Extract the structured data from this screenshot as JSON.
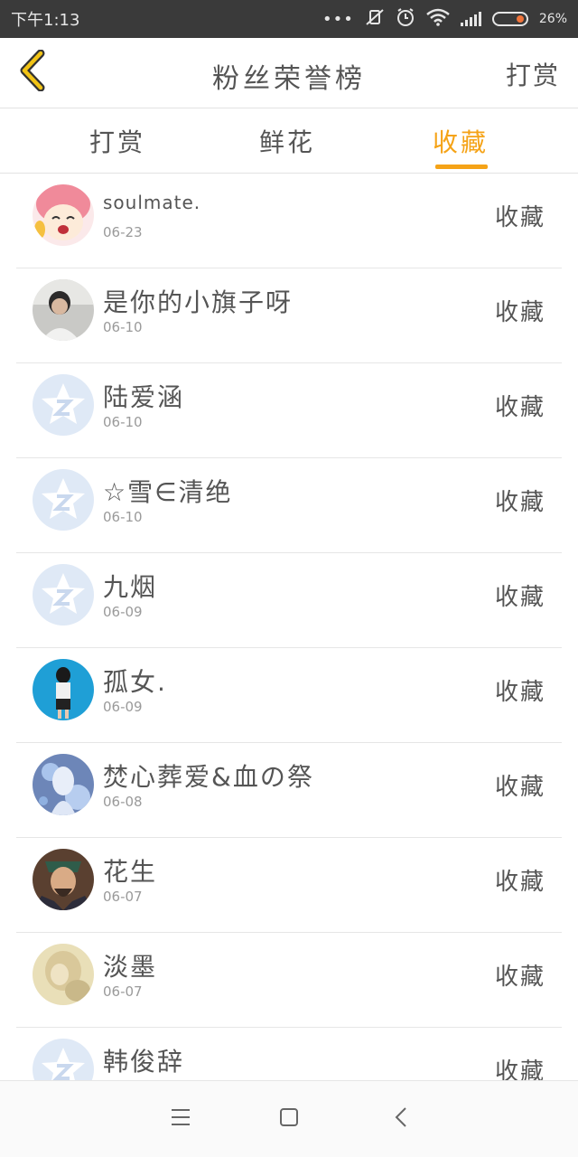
{
  "status_bar": {
    "time": "下午1:13",
    "battery": "26%",
    "accent": "#f0743a"
  },
  "header": {
    "title": "粉丝荣誉榜",
    "action": "打赏"
  },
  "tabs": [
    {
      "label": "打赏",
      "active": false
    },
    {
      "label": "鲜花",
      "active": false
    },
    {
      "label": "收藏",
      "active": true
    }
  ],
  "accent_color": "#f5a317",
  "fans": [
    {
      "name": "soulmate.",
      "date": "06-23",
      "action": "收藏",
      "avatar": "anime-pink-hair"
    },
    {
      "name": "是你的小旗子呀",
      "date": "06-10",
      "action": "收藏",
      "avatar": "photo-person"
    },
    {
      "name": "陆爱涵",
      "date": "06-10",
      "action": "收藏",
      "avatar": "default-qq"
    },
    {
      "name": "☆雪∈清绝",
      "date": "06-10",
      "action": "收藏",
      "avatar": "default-qq"
    },
    {
      "name": "九烟",
      "date": "06-09",
      "action": "收藏",
      "avatar": "default-qq"
    },
    {
      "name": "孤女.",
      "date": "06-09",
      "action": "收藏",
      "avatar": "photo-girl-blue"
    },
    {
      "name": "焚心葬爱&血の祭",
      "date": "06-08",
      "action": "收藏",
      "avatar": "anime-snow"
    },
    {
      "name": "花生",
      "date": "06-07",
      "action": "收藏",
      "avatar": "warrior"
    },
    {
      "name": "淡墨",
      "date": "06-07",
      "action": "收藏",
      "avatar": "blurred-photo"
    },
    {
      "name": "韩俊辞",
      "date": "",
      "action": "收藏",
      "avatar": "default-qq"
    }
  ]
}
